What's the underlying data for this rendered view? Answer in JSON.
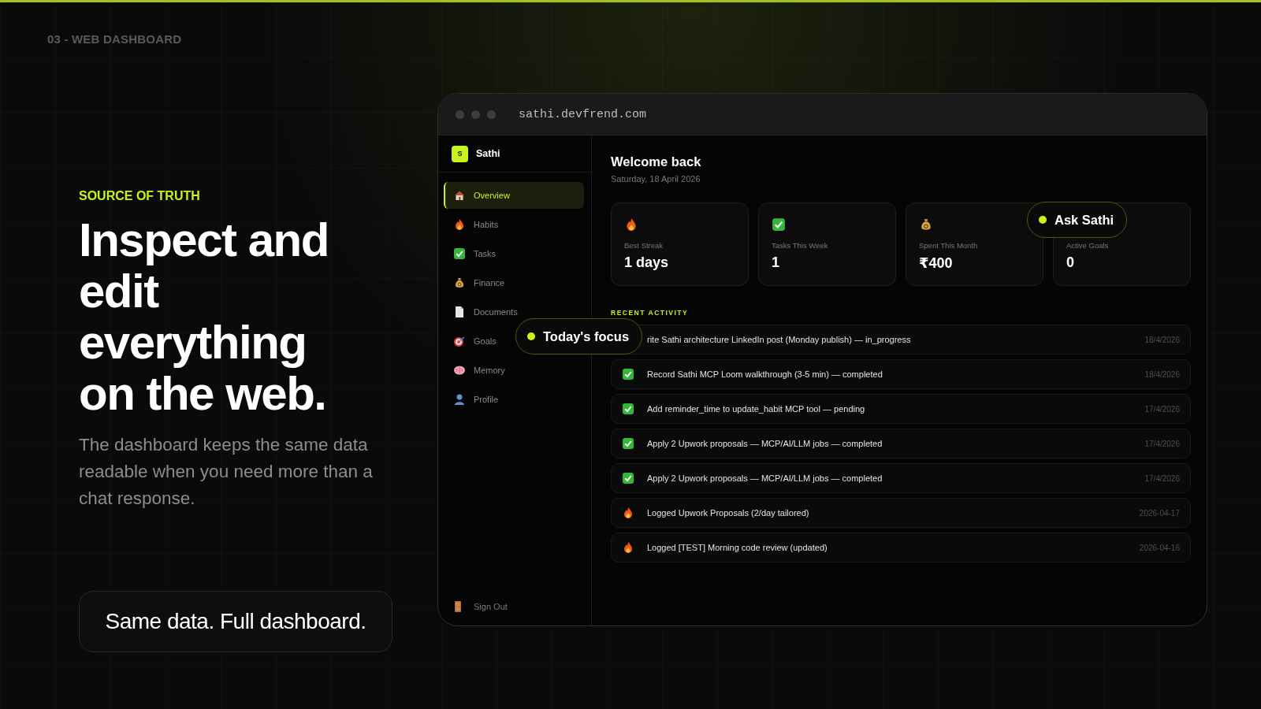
{
  "section_label": "03 - WEB DASHBOARD",
  "eyebrow": "SOURCE OF TRUTH",
  "headline": "Inspect and edit everything on the web.",
  "description": "The dashboard keeps the same data readable when you need more than a chat response.",
  "callout": "Same data. Full dashboard.",
  "browser": {
    "url": "sathi.devfrend.com"
  },
  "sidebar": {
    "logo_letter": "S",
    "brand": "Sathi",
    "items": [
      {
        "label": "Overview",
        "kind": "house",
        "selected": true
      },
      {
        "label": "Habits",
        "kind": "flame",
        "selected": false
      },
      {
        "label": "Tasks",
        "kind": "check",
        "selected": false
      },
      {
        "label": "Finance",
        "kind": "moneybag",
        "selected": false
      },
      {
        "label": "Documents",
        "kind": "document",
        "selected": false
      },
      {
        "label": "Goals",
        "kind": "target",
        "selected": false
      },
      {
        "label": "Memory",
        "kind": "brain",
        "selected": false
      },
      {
        "label": "Profile",
        "kind": "person",
        "selected": false
      }
    ],
    "sign_out": {
      "label": "Sign Out"
    }
  },
  "main": {
    "title": "Welcome back",
    "date": "Saturday, 18 April 2026",
    "stats": [
      {
        "kind": "flame",
        "label": "Best Streak",
        "value": "1 days"
      },
      {
        "kind": "check",
        "label": "Tasks This Week",
        "value": "1"
      },
      {
        "kind": "moneybag",
        "label": "Spent This Month",
        "value": "₹400"
      },
      {
        "kind": "plain",
        "label": "Active Goals",
        "value": "0"
      }
    ],
    "recent_heading": "RECENT ACTIVITY",
    "activity": [
      {
        "kind": "plain",
        "text": "rite Sathi architecture LinkedIn post (Monday publish) — in_progress",
        "date": "18/4/2026"
      },
      {
        "kind": "check",
        "text": "Record Sathi MCP Loom walkthrough (3-5 min) — completed",
        "date": "18/4/2026"
      },
      {
        "kind": "check",
        "text": "Add reminder_time to update_habit MCP tool — pending",
        "date": "17/4/2026"
      },
      {
        "kind": "check",
        "text": "Apply 2 Upwork proposals — MCP/AI/LLM jobs — completed",
        "date": "17/4/2026"
      },
      {
        "kind": "check",
        "text": "Apply 2 Upwork proposals — MCP/AI/LLM jobs — completed",
        "date": "17/4/2026"
      },
      {
        "kind": "flame",
        "text": "Logged Upwork Proposals (2/day tailored)",
        "date": "2026-04-17"
      },
      {
        "kind": "flame",
        "text": "Logged [TEST] Morning code review (updated)",
        "date": "2026-04-16"
      }
    ]
  },
  "floating_tags": [
    {
      "label": "Today's focus"
    },
    {
      "label": "Ask Sathi"
    }
  ]
}
